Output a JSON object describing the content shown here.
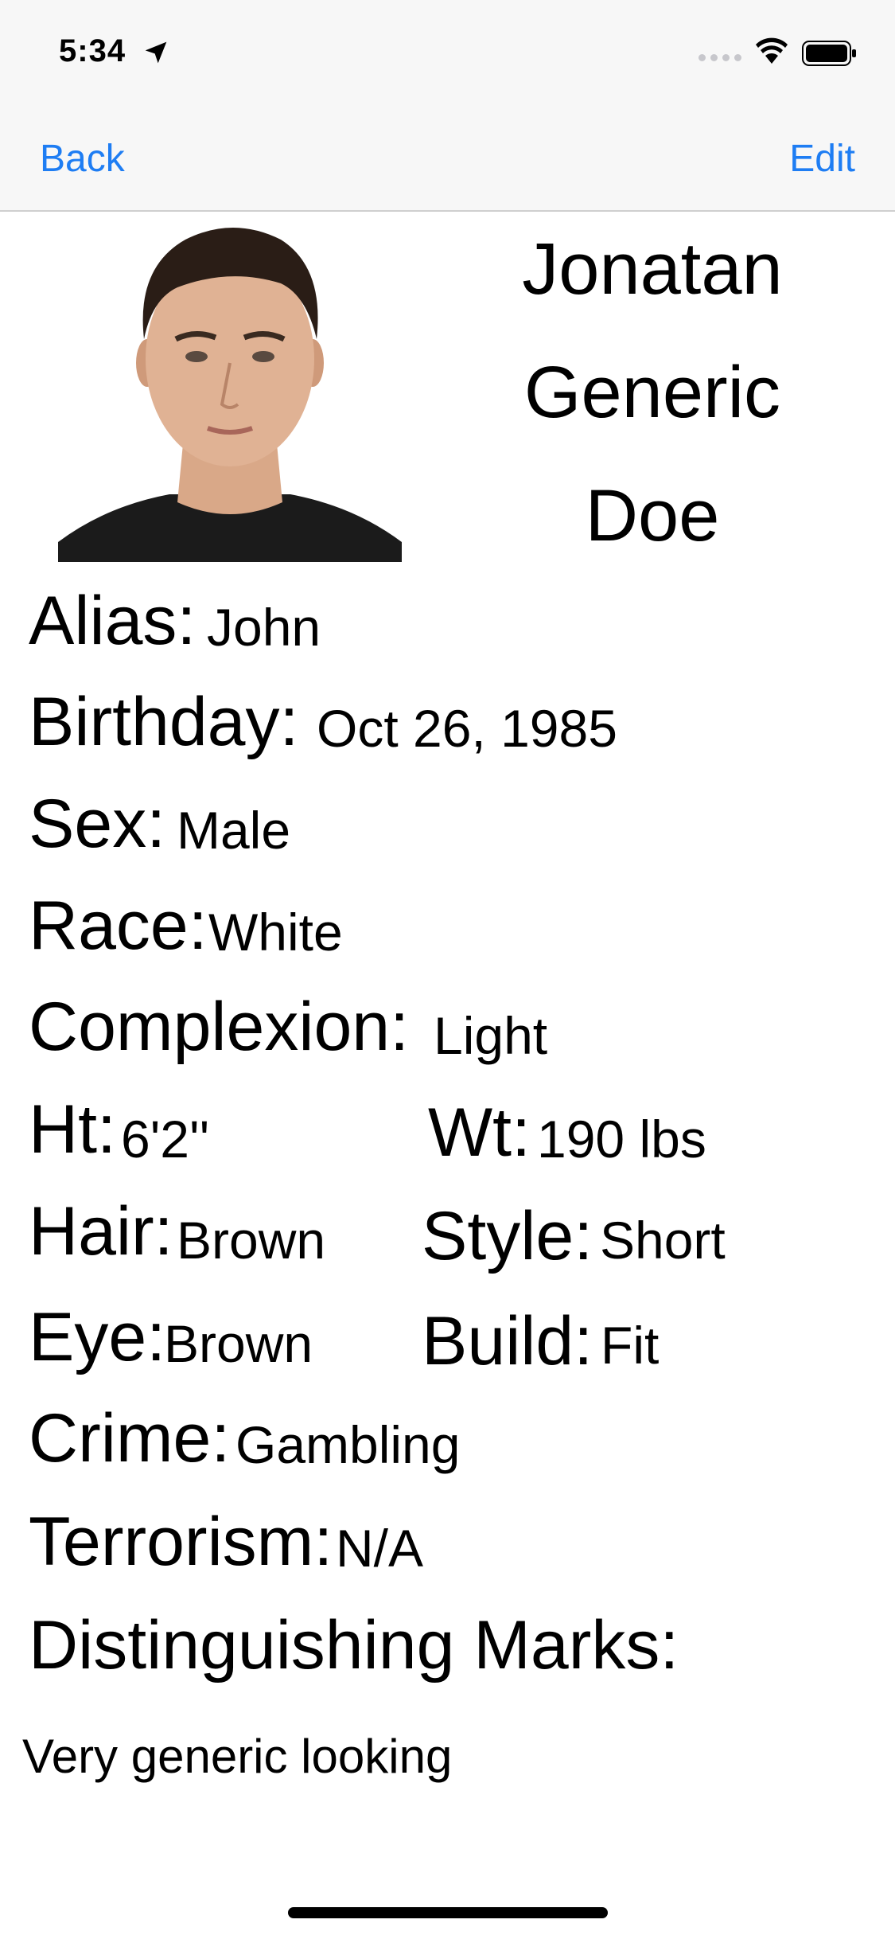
{
  "status_bar": {
    "time": "5:34"
  },
  "nav": {
    "back_label": "Back",
    "edit_label": "Edit"
  },
  "profile": {
    "name_lines": [
      "Jonatan",
      "Generic",
      "Doe"
    ],
    "photo_alt": "profile photo"
  },
  "fields": {
    "alias_label": "Alias:",
    "alias_value": "John",
    "birthday_label": "Birthday:",
    "birthday_value": "Oct 26, 1985",
    "sex_label": "Sex:",
    "sex_value": "Male",
    "race_label": "Race:",
    "race_value": "White",
    "complexion_label": "Complexion:",
    "complexion_value": "Light",
    "height_label": "Ht:",
    "height_value": "6'2''",
    "weight_label": "Wt:",
    "weight_value": "190 lbs",
    "hair_label": "Hair:",
    "hair_value": "Brown",
    "style_label": "Style:",
    "style_value": "Short",
    "eye_label": "Eye:",
    "eye_value": "Brown",
    "build_label": "Build:",
    "build_value": "Fit",
    "crime_label": "Crime:",
    "crime_value": "Gambling",
    "terrorism_label": "Terrorism:",
    "terrorism_value": "N/A",
    "marks_label": "Distinguishing Marks:",
    "marks_value": "Very generic looking"
  },
  "colors": {
    "accent": "#1e7df3",
    "bar_bg": "#f7f7f7"
  }
}
